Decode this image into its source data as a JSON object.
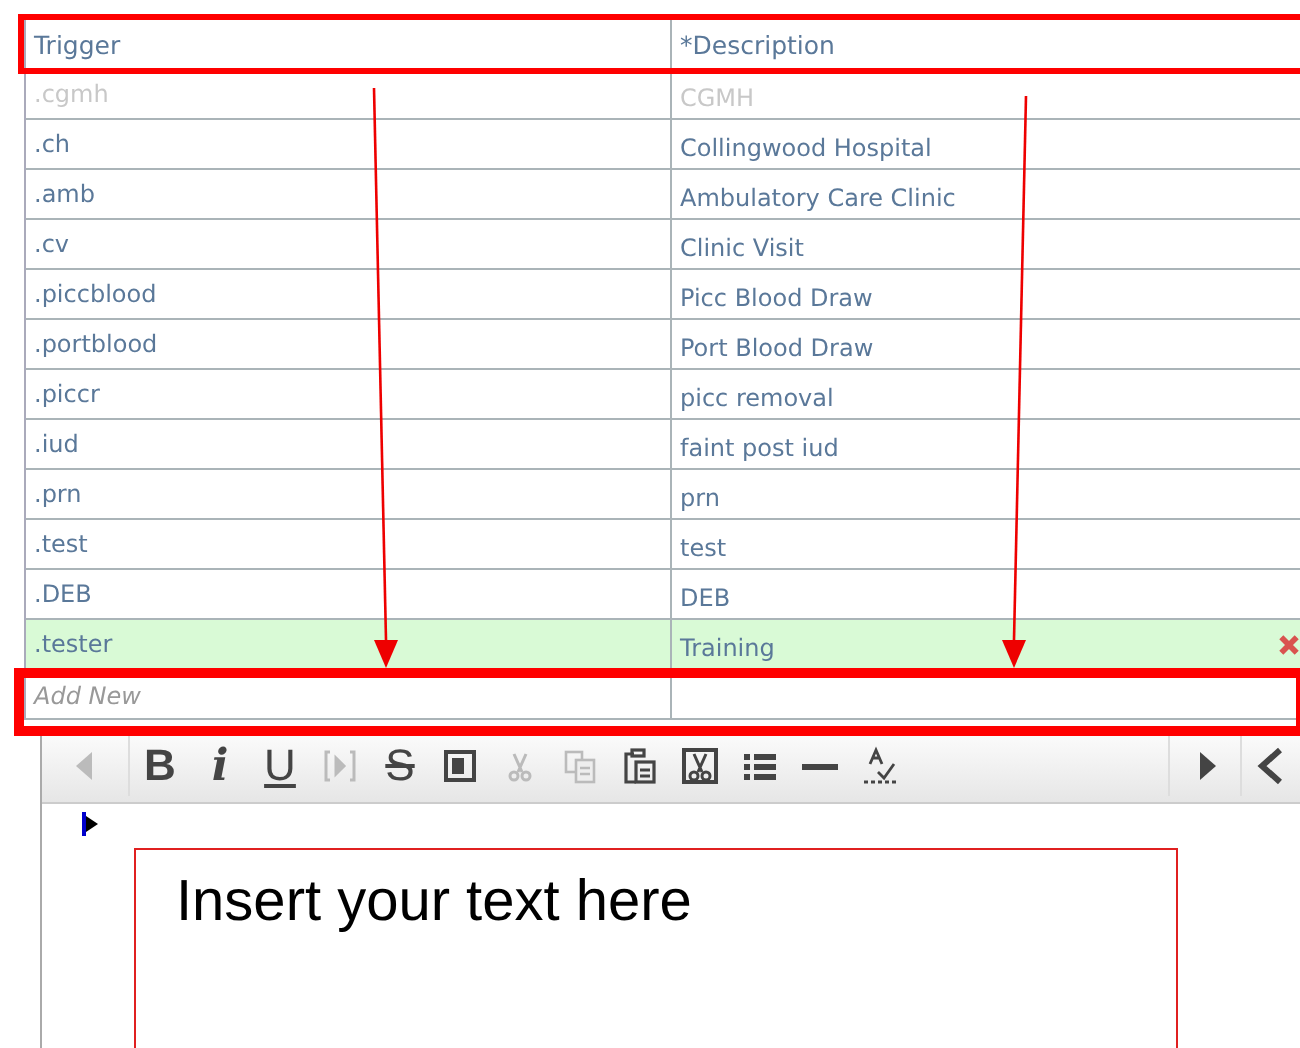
{
  "table": {
    "columns": [
      "Trigger",
      "*Description"
    ],
    "rows": [
      {
        "trigger": ".cgmh",
        "description": "CGMH",
        "disabled": true,
        "selected": false
      },
      {
        "trigger": ".ch",
        "description": "Collingwood Hospital",
        "disabled": false,
        "selected": false
      },
      {
        "trigger": ".amb",
        "description": "Ambulatory Care Clinic",
        "disabled": false,
        "selected": false
      },
      {
        "trigger": ".cv",
        "description": "Clinic Visit",
        "disabled": false,
        "selected": false
      },
      {
        "trigger": ".piccblood",
        "description": "Picc Blood Draw",
        "disabled": false,
        "selected": false
      },
      {
        "trigger": ".portblood",
        "description": "Port Blood Draw",
        "disabled": false,
        "selected": false
      },
      {
        "trigger": ".piccr",
        "description": "picc removal",
        "disabled": false,
        "selected": false
      },
      {
        "trigger": ".iud",
        "description": "faint post iud",
        "disabled": false,
        "selected": false
      },
      {
        "trigger": ".prn",
        "description": "prn",
        "disabled": false,
        "selected": false
      },
      {
        "trigger": ".test",
        "description": "test",
        "disabled": false,
        "selected": false
      },
      {
        "trigger": ".DEB",
        "description": "DEB",
        "disabled": false,
        "selected": false
      },
      {
        "trigger": ".tester",
        "description": "Training",
        "disabled": false,
        "selected": true
      }
    ],
    "add_row": {
      "placeholder": "Add New"
    }
  },
  "toolbar": [
    {
      "kind": "prev",
      "disabled": true
    },
    {
      "kind": "bold",
      "label": "B",
      "disabled": false
    },
    {
      "kind": "italic",
      "label": "i",
      "disabled": false
    },
    {
      "kind": "underline",
      "label": "U",
      "disabled": false
    },
    {
      "kind": "field",
      "disabled": true
    },
    {
      "kind": "strike",
      "label": "S",
      "disabled": false
    },
    {
      "kind": "block",
      "disabled": false
    },
    {
      "kind": "cut",
      "disabled": true
    },
    {
      "kind": "copy",
      "disabled": true
    },
    {
      "kind": "paste",
      "disabled": false
    },
    {
      "kind": "cutbox",
      "disabled": false
    },
    {
      "kind": "list",
      "disabled": false
    },
    {
      "kind": "rule",
      "disabled": false
    },
    {
      "kind": "spell",
      "disabled": false
    },
    {
      "kind": "next",
      "disabled": false
    },
    {
      "kind": "back",
      "disabled": false
    }
  ],
  "editor": {
    "callout": "Insert your text here"
  }
}
